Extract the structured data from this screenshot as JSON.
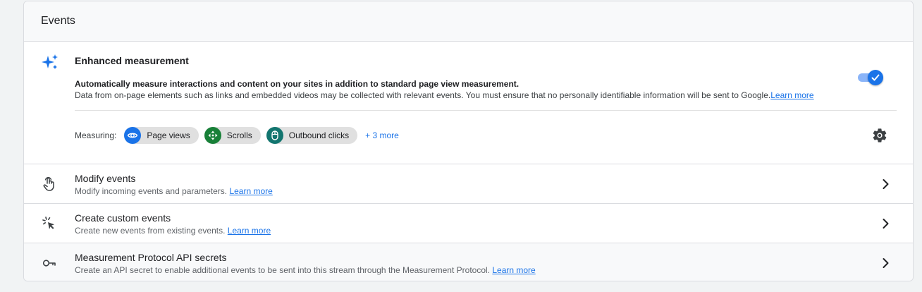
{
  "header": {
    "title": "Events"
  },
  "enhanced_measurement": {
    "title": "Enhanced measurement",
    "description_bold": "Automatically measure interactions and content on your sites in addition to standard page view measurement.",
    "description": "Data from on-page elements such as links and embedded videos may be collected with relevant events. You must ensure that no personally identifiable information will be sent to Google.",
    "learn_more": "Learn more",
    "toggle_on": true,
    "measuring_label": "Measuring:",
    "chips": [
      {
        "label": "Page views",
        "icon": "eye-icon",
        "color": "#1a73e8"
      },
      {
        "label": "Scrolls",
        "icon": "scroll-arrows-icon",
        "color": "#188038"
      },
      {
        "label": "Outbound clicks",
        "icon": "mouse-icon",
        "color": "#12756f"
      }
    ],
    "more": "+ 3 more"
  },
  "rows": [
    {
      "title": "Modify events",
      "subtitle": "Modify incoming events and parameters.",
      "link": "Learn more",
      "icon": "touch-hand-icon"
    },
    {
      "title": "Create custom events",
      "subtitle": "Create new events from existing events.",
      "link": "Learn more",
      "icon": "cursor-click-icon"
    },
    {
      "title": "Measurement Protocol API secrets",
      "subtitle": "Create an API secret to enable additional events to be sent into this stream through the Measurement Protocol.",
      "link": "Learn more",
      "icon": "key-icon"
    }
  ],
  "colors": {
    "accent": "#1a73e8",
    "toggle_track": "#8ab4f8",
    "scrolls_chip": "#188038",
    "outbound_chip": "#12756f"
  }
}
